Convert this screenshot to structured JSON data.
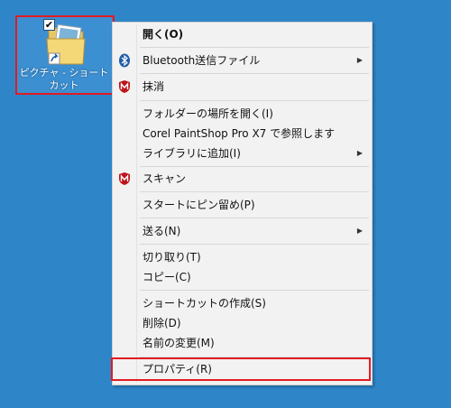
{
  "desktop": {
    "background_color": "#2e86c9",
    "shortcut": {
      "label": "ピクチャ - ショートカット",
      "icon": "pictures-folder-shortcut-icon",
      "checked_mark": "✔"
    }
  },
  "context_menu": {
    "items": [
      {
        "label": "開く(O)",
        "bold": true
      },
      {
        "label": "Bluetooth送信ファイル",
        "icon": "bluetooth-icon",
        "submenu": true
      },
      {
        "label": "抹消",
        "icon": "mcafee-shield-icon"
      },
      {
        "label": "フォルダーの場所を開く(I)"
      },
      {
        "label": "Corel PaintShop Pro X7 で参照します"
      },
      {
        "label": "ライブラリに追加(I)",
        "submenu": true
      },
      {
        "label": "スキャン",
        "icon": "mcafee-shield-icon"
      },
      {
        "label": "スタートにピン留め(P)"
      },
      {
        "label": "送る(N)",
        "submenu": true
      },
      {
        "label": "切り取り(T)"
      },
      {
        "label": "コピー(C)"
      },
      {
        "label": "ショートカットの作成(S)"
      },
      {
        "label": "削除(D)"
      },
      {
        "label": "名前の変更(M)"
      },
      {
        "label": "プロパティ(R)"
      }
    ],
    "submenu_arrow": "▶"
  },
  "annotation": {
    "highlight_color": "#e21b22"
  }
}
